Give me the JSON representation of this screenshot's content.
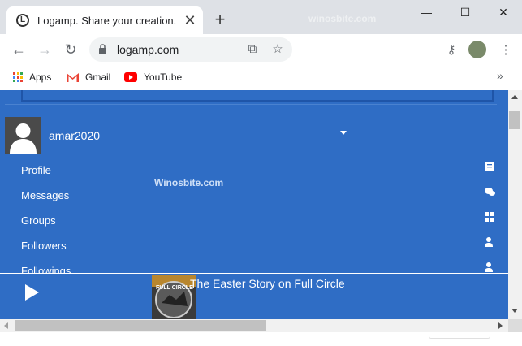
{
  "browser": {
    "tab_title": "Logamp. Share your creation.",
    "tab_favicon_letter": "L",
    "address": "logamp.com",
    "watermark": "winosbite.com"
  },
  "bookmarks": [
    {
      "label": "Apps",
      "icon": "apps-grid-icon"
    },
    {
      "label": "Gmail",
      "icon": "gmail-icon"
    },
    {
      "label": "YouTube",
      "icon": "youtube-icon"
    }
  ],
  "page": {
    "username": "amar2020",
    "menu": [
      {
        "label": "Profile",
        "icon": "profile-book-icon"
      },
      {
        "label": "Messages",
        "icon": "chat-bubbles-icon"
      },
      {
        "label": "Groups",
        "icon": "groups-icon"
      },
      {
        "label": "Followers",
        "icon": "user-follow-icon"
      },
      {
        "label": "Followings",
        "icon": "user-following-icon"
      }
    ],
    "watermark": "Winosbite.com"
  },
  "player": {
    "track_title": "The Easter Story on Full Circle",
    "album_text": "FULL CIRCLE"
  },
  "colors": {
    "content_bg": "#2f6dc5",
    "chrome_bg": "#dee1e6"
  }
}
